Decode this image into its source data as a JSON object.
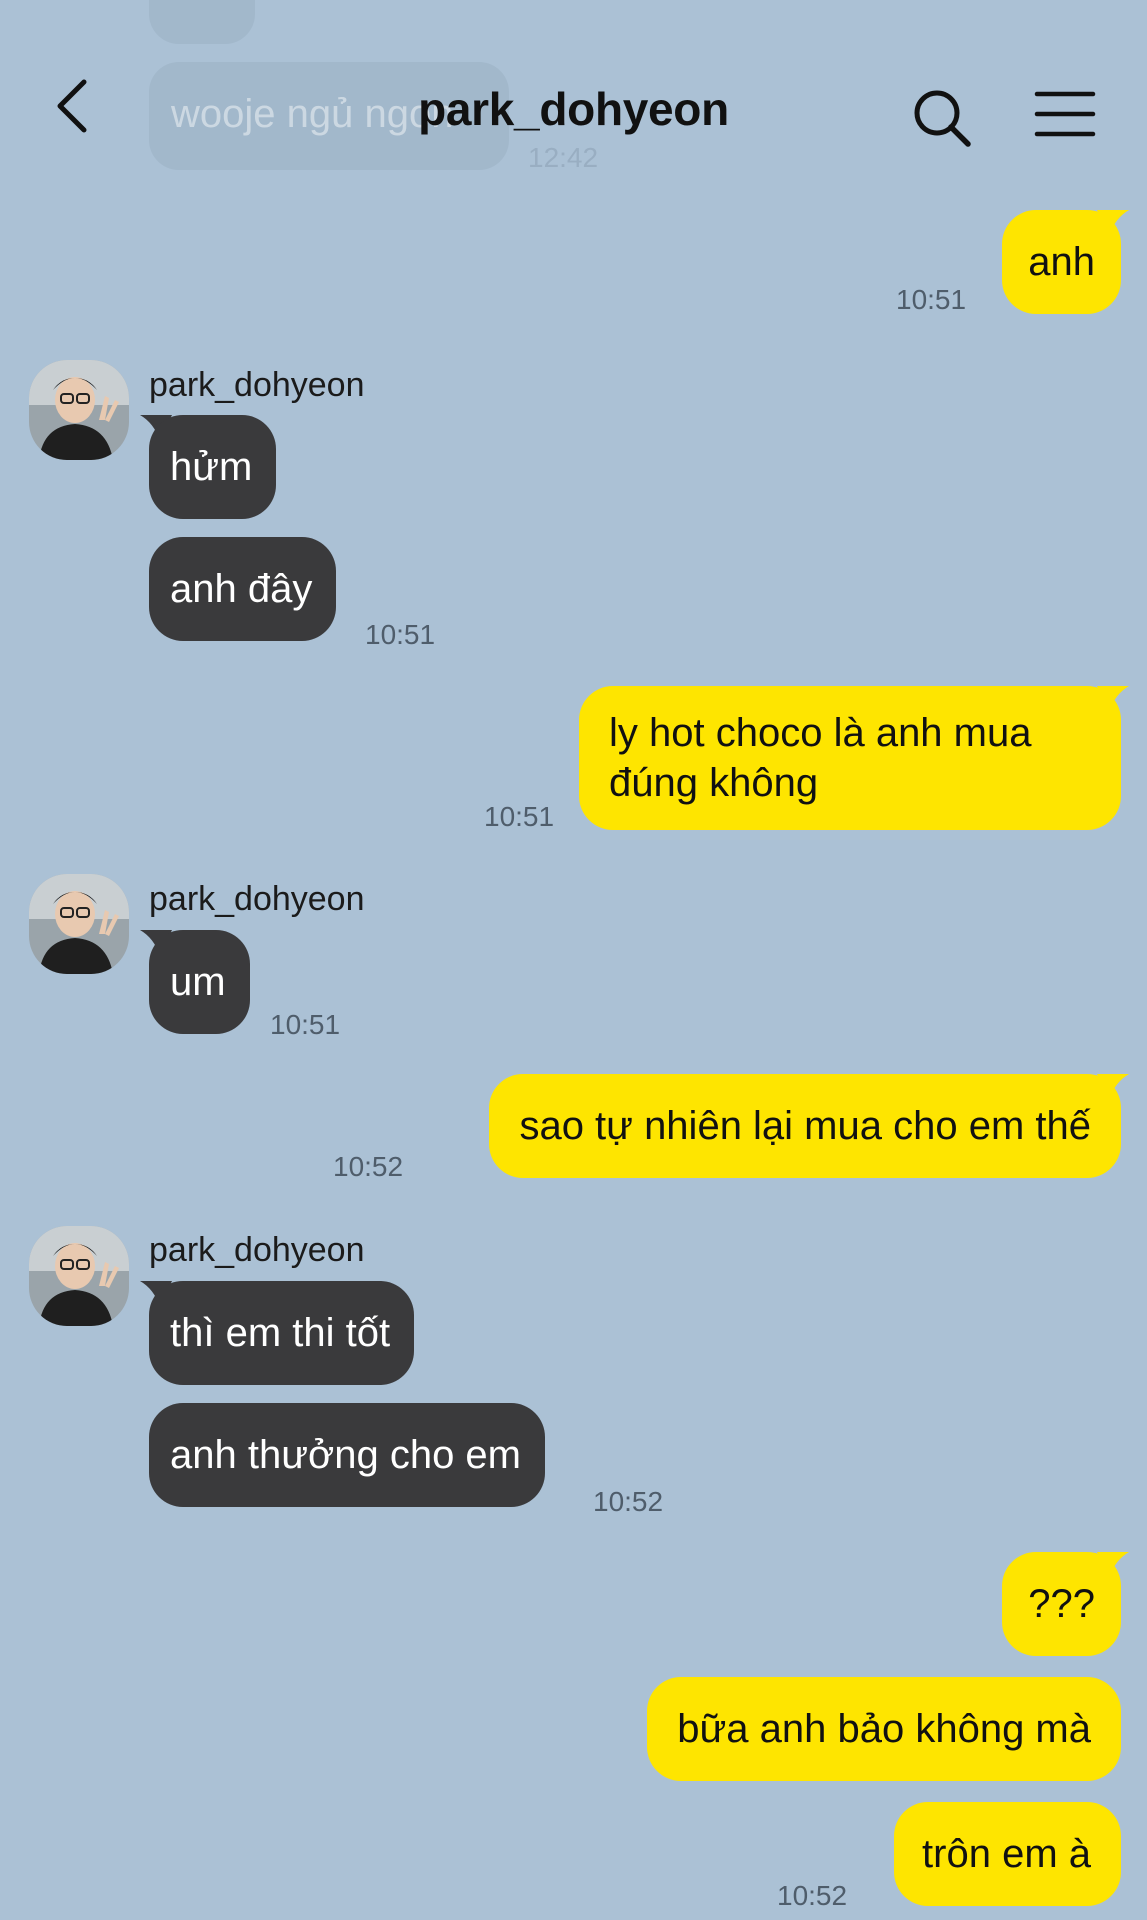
{
  "header": {
    "title": "park_dohyeon"
  },
  "ghost": {
    "message": "wooje ngủ ngon",
    "time": "12:42"
  },
  "messages": [
    {
      "from": "me",
      "text": "anh",
      "time": "10:51"
    },
    {
      "from": "them",
      "sender": "park_dohyeon",
      "text": "hửm"
    },
    {
      "from": "them",
      "text": "anh đây",
      "time": "10:51"
    },
    {
      "from": "me",
      "text": "ly hot choco là anh mua đúng không",
      "time": "10:51"
    },
    {
      "from": "them",
      "sender": "park_dohyeon",
      "text": "um",
      "time": "10:51"
    },
    {
      "from": "me",
      "text": "sao tự nhiên lại mua cho em thế",
      "time": "10:52"
    },
    {
      "from": "them",
      "sender": "park_dohyeon",
      "text": "thì em thi tốt"
    },
    {
      "from": "them",
      "text": "anh thưởng cho em",
      "time": "10:52"
    },
    {
      "from": "me",
      "text": "???"
    },
    {
      "from": "me",
      "text": "bữa anh bảo không mà"
    },
    {
      "from": "me",
      "text": "trôn em à",
      "time": "10:52"
    }
  ],
  "colors": {
    "background": "#abc1d5",
    "my_bubble": "#fee500",
    "their_bubble": "#3a3a3c"
  },
  "icons": {
    "back": "chevron-left-icon",
    "search": "search-icon",
    "menu": "hamburger-menu-icon"
  }
}
